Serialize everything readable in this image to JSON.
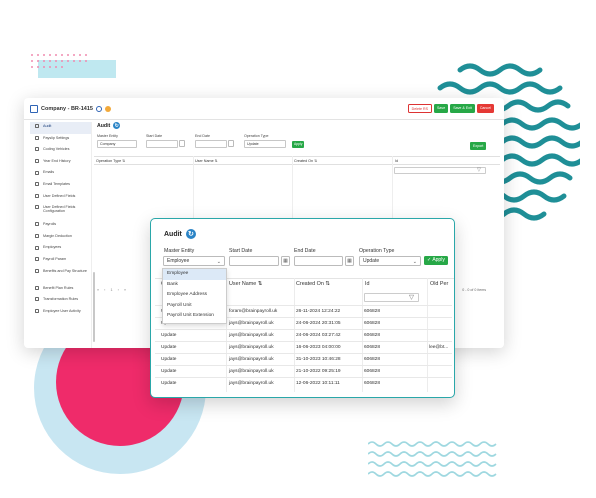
{
  "main_window": {
    "title": "Company - BR-1415",
    "header_buttons": {
      "delete": "Delete RS",
      "save": "Save",
      "save_exit": "Save & Exit",
      "cancel": "Cancel"
    },
    "sidebar_items": [
      {
        "label": "Audit",
        "active": true
      },
      {
        "label": "Payslip Settings"
      },
      {
        "label": "Coding Vehicles"
      },
      {
        "label": "Year End History"
      },
      {
        "label": "Emails"
      },
      {
        "label": "Email Templates"
      },
      {
        "label": "User Defined Fields"
      },
      {
        "label": "User Defined Fields Configuration"
      },
      {
        "label": "Payrolls"
      },
      {
        "label": "Margin Deduction"
      },
      {
        "label": "Employees"
      },
      {
        "label": "Payroll Param"
      },
      {
        "label": "Benefits and Pay Structure"
      },
      {
        "label": "Benefit Plan Rules"
      },
      {
        "label": "Transformation Rules"
      },
      {
        "label": "Employee User Activity"
      }
    ],
    "section_title": "Audit",
    "filters": {
      "master_entity_label": "Master Entity",
      "master_entity_value": "Company",
      "start_date_label": "Start Date",
      "end_date_label": "End Date",
      "operation_type_label": "Operation Type",
      "operation_type_value": "Update",
      "apply_label": "Apply",
      "export_label": "Export"
    },
    "table_headers": {
      "operation_type": "Operation Type",
      "user_name": "User Name",
      "created_on": "Created On",
      "id": "Id"
    },
    "pager_left": "« ‹ 1 › »",
    "pager_right": "0 - 0 of 0 items"
  },
  "popup": {
    "title": "Audit",
    "filters": {
      "master_entity_label": "Master Entity",
      "master_entity_value": "Employee",
      "start_date_label": "Start Date",
      "end_date_label": "End Date",
      "operation_type_label": "Operation Type",
      "operation_type_value": "Update",
      "apply_label": "Apply"
    },
    "dropdown_options": [
      "Employee",
      "Bank",
      "Employee Address",
      "Payroll Unit",
      "Payroll Unit Extension"
    ],
    "table_headers": {
      "operation_type": "O",
      "user_name": "User Name",
      "created_on": "Created On",
      "id": "Id",
      "old_value": "Old Per"
    },
    "rows": [
      {
        "op": "Update",
        "user": "foram@brainpayroll.uk",
        "created": "26-11-2024 12:24:22",
        "id": "606828",
        "old": ""
      },
      {
        "op": "Update",
        "user": "jays@brainpayroll.uk",
        "created": "24-06-2024 20:31:05",
        "id": "606828",
        "old": ""
      },
      {
        "op": "Update",
        "user": "jays@brainpayroll.uk",
        "created": "24-06-2024 03:27:42",
        "id": "606828",
        "old": ""
      },
      {
        "op": "Update",
        "user": "jays@brainpayroll.uk",
        "created": "16-06-2023 04:00:00",
        "id": "606828",
        "old": "lee@bt..."
      },
      {
        "op": "Update",
        "user": "jays@brainpayroll.uk",
        "created": "31-10-2023 10:46:28",
        "id": "606828",
        "old": ""
      },
      {
        "op": "Update",
        "user": "jays@brainpayroll.uk",
        "created": "21-10-2022 09:25:19",
        "id": "606828",
        "old": ""
      },
      {
        "op": "Update",
        "user": "jays@brainpayroll.uk",
        "created": "12-06-2022 10:11:11",
        "id": "606828",
        "old": ""
      }
    ]
  },
  "colors": {
    "accent_teal": "#2aa7a9",
    "apply_green": "#27a847",
    "cancel_red": "#e53935",
    "pink_circle": "#ef2b6a",
    "ring_blue": "#c8e6f2",
    "wave_teal": "#1f8f97"
  }
}
